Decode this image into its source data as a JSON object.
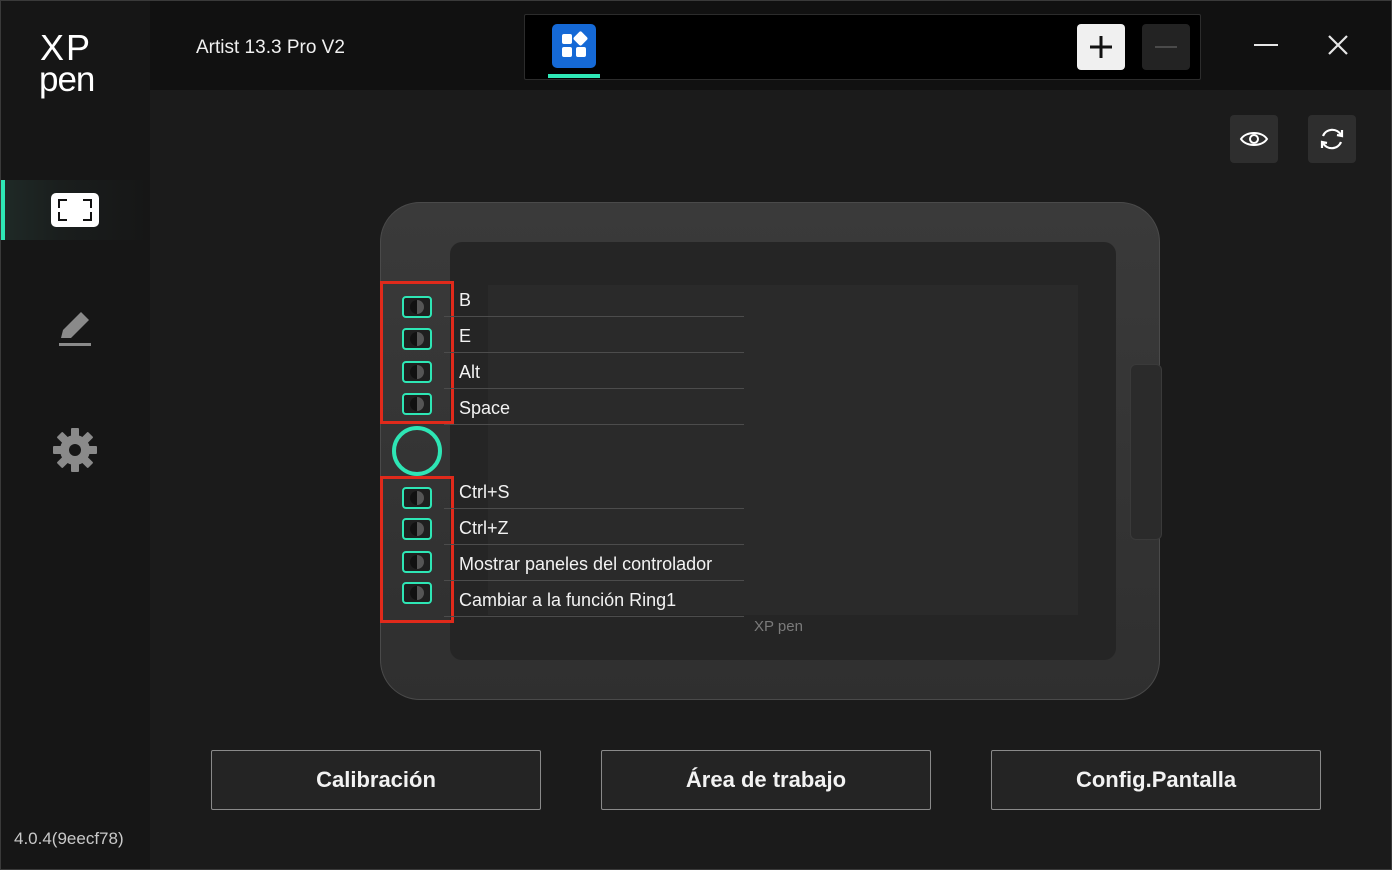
{
  "app": {
    "logo_top": "XP",
    "logo_bottom": "pen",
    "version": "4.0.4(9eecf78)",
    "accent_color": "#2ee6b5"
  },
  "header": {
    "device_name": "Artist 13.3 Pro V2",
    "tabs": [
      {
        "icon": "app-grid-icon",
        "active": true
      }
    ],
    "add_icon": "plus-icon",
    "remove_icon": "minus-icon",
    "window_controls": [
      "minimize-icon",
      "close-icon"
    ]
  },
  "sidebar": {
    "items": [
      {
        "icon": "display-area-icon",
        "active": true
      },
      {
        "icon": "pen-icon",
        "active": false
      },
      {
        "icon": "gear-icon",
        "active": false
      }
    ]
  },
  "toolbar": {
    "icons": [
      "eye-icon",
      "refresh-icon"
    ]
  },
  "tablet": {
    "brand": "XP pen",
    "top_keys": [
      "B",
      "E",
      "Alt",
      "Space"
    ],
    "bottom_keys": [
      "Ctrl+S",
      "Ctrl+Z",
      "Mostrar paneles del controlador",
      "Cambiar a la función Ring1"
    ]
  },
  "actions": {
    "calibration": "Calibración",
    "work_area": "Área de trabajo",
    "display_config": "Config.Pantalla"
  }
}
